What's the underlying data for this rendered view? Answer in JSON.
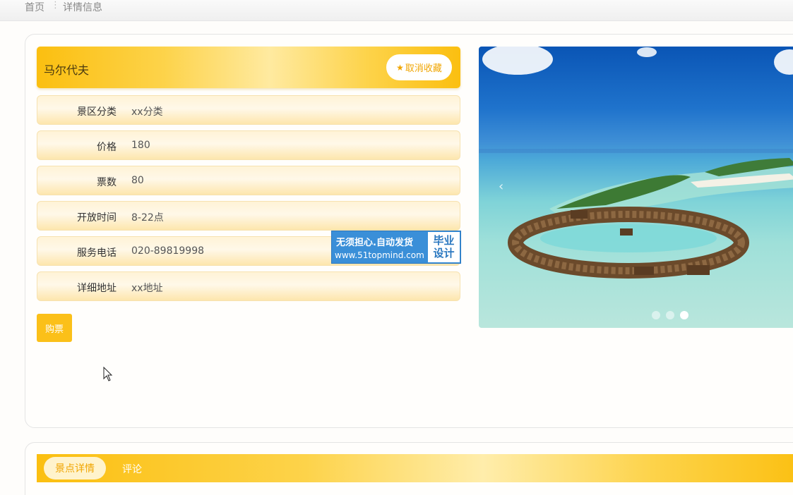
{
  "breadcrumb": {
    "home": "首页",
    "separator": "⋮",
    "current": "详情信息"
  },
  "detail": {
    "title": "马尔代夫",
    "favorite_label": "取消收藏",
    "favorite_icon": "star-icon",
    "fields": [
      {
        "label": "景区分类",
        "value": "xx分类"
      },
      {
        "label": "价格",
        "value": "180"
      },
      {
        "label": "票数",
        "value": "80"
      },
      {
        "label": "开放时间",
        "value": "8-22点"
      },
      {
        "label": "服务电话",
        "value": "020-89819998"
      },
      {
        "label": "详细地址",
        "value": "xx地址"
      }
    ],
    "buy_label": "购票"
  },
  "watermark": {
    "line1": "无须担心.自动发货",
    "line2": "www.51topmind.com",
    "side1": "毕业",
    "side2": "设计"
  },
  "carousel": {
    "prev_icon": "chevron-left-icon",
    "prev_glyph": "‹",
    "slide_count": 3,
    "active_index": 2
  },
  "tabs": [
    {
      "label": "景点详情",
      "active": true
    },
    {
      "label": "评论",
      "active": false
    }
  ],
  "colors": {
    "accent": "#fbc019",
    "accent_text": "#f0a500",
    "row_bg": "#fff3d6"
  }
}
